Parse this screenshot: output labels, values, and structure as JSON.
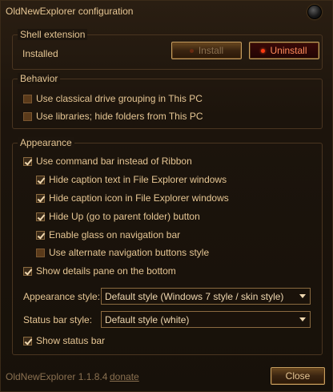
{
  "window": {
    "title": "OldNewExplorer configuration",
    "close_icon": "close-orb-icon"
  },
  "shell": {
    "legend": "Shell extension",
    "status": "Installed",
    "install_label": "Install",
    "uninstall_label": "Uninstall"
  },
  "behavior": {
    "legend": "Behavior",
    "options": [
      {
        "label": "Use classical drive grouping in This PC",
        "checked": false
      },
      {
        "label": "Use libraries; hide folders from This PC",
        "checked": false
      }
    ]
  },
  "appearance": {
    "legend": "Appearance",
    "command_bar": {
      "label": "Use command bar instead of Ribbon",
      "checked": true
    },
    "sub_options": [
      {
        "label": "Hide caption text in File Explorer windows",
        "checked": true
      },
      {
        "label": "Hide caption icon in File Explorer windows",
        "checked": true
      },
      {
        "label": "Hide Up (go to parent folder) button",
        "checked": true
      },
      {
        "label": "Enable glass on navigation bar",
        "checked": true
      },
      {
        "label": "Use alternate navigation buttons style",
        "checked": false
      }
    ],
    "details_pane": {
      "label": "Show details pane on the bottom",
      "checked": true
    },
    "appearance_style_label": "Appearance style:",
    "appearance_style_value": "Default style (Windows 7 style / skin style)",
    "status_bar_style_label": "Status bar style:",
    "status_bar_style_value": "Default style (white)",
    "status_bar": {
      "label": "Show status bar",
      "checked": true
    }
  },
  "footer": {
    "version": "OldNewExplorer 1.1.8.4",
    "donate": "donate",
    "close_label": "Close"
  }
}
